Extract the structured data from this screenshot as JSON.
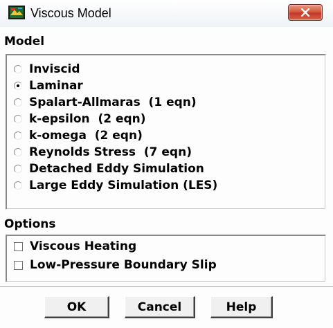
{
  "window": {
    "title": "Viscous Model",
    "close_icon": "close-icon",
    "app_icon": "app-icon"
  },
  "model": {
    "heading": "Model",
    "selected": "Laminar",
    "options": [
      {
        "label": "Inviscid",
        "checked": false
      },
      {
        "label": "Laminar",
        "checked": true
      },
      {
        "label": "Spalart-Allmaras  (1 eqn)",
        "checked": false
      },
      {
        "label": "k-epsilon  (2 eqn)",
        "checked": false
      },
      {
        "label": "k-omega  (2 eqn)",
        "checked": false
      },
      {
        "label": "Reynolds Stress  (7 eqn)",
        "checked": false
      },
      {
        "label": "Detached Eddy Simulation",
        "checked": false
      },
      {
        "label": "Large Eddy Simulation (LES)",
        "checked": false
      }
    ]
  },
  "options": {
    "heading": "Options",
    "items": [
      {
        "label": "Viscous Heating",
        "checked": false
      },
      {
        "label": "Low-Pressure Boundary Slip",
        "checked": false
      }
    ]
  },
  "buttons": {
    "ok": "OK",
    "cancel": "Cancel",
    "help": "Help"
  },
  "colors": {
    "close_button": "#c4372a",
    "dialog_background": "#fdfdfd",
    "text": "#000000"
  }
}
